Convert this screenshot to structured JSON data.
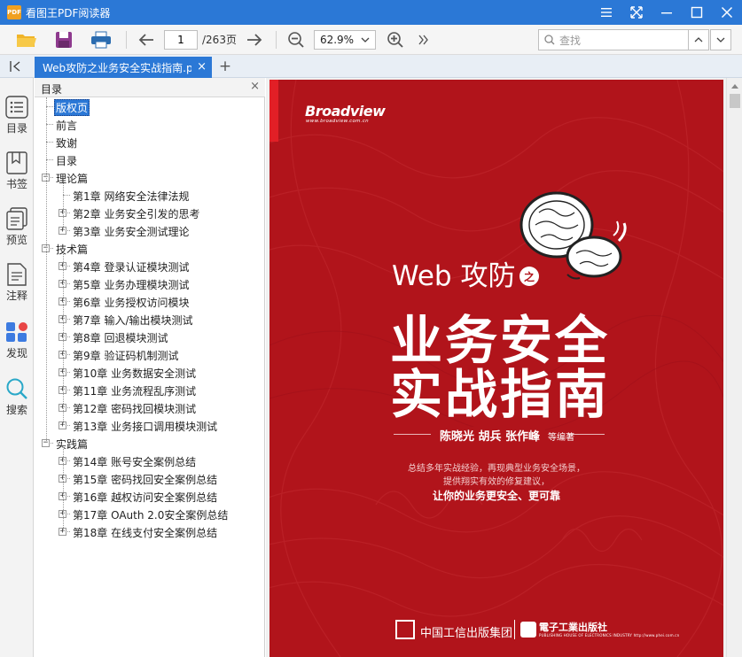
{
  "app": {
    "title": "看图王PDF阅读器",
    "logo_text": "PDF"
  },
  "toolbar": {
    "page_current": "1",
    "page_total": "/263页",
    "zoom": "62.9%",
    "search_placeholder": "查找"
  },
  "tab": {
    "label": "Web攻防之业务安全实战指南.p",
    "close": "×",
    "add": "+"
  },
  "sidebar": {
    "items": [
      {
        "label": "目录",
        "icon": "list-icon"
      },
      {
        "label": "书签",
        "icon": "bookmark-icon"
      },
      {
        "label": "预览",
        "icon": "thumbnails-icon"
      },
      {
        "label": "注释",
        "icon": "annotation-icon"
      },
      {
        "label": "发现",
        "icon": "apps-icon"
      },
      {
        "label": "搜索",
        "icon": "search-icon"
      }
    ]
  },
  "toc": {
    "title": "目录",
    "close": "×",
    "items": [
      {
        "label": "版权页",
        "level": 0,
        "toggle": "",
        "selected": true
      },
      {
        "label": "前言",
        "level": 0,
        "toggle": ""
      },
      {
        "label": "致谢",
        "level": 0,
        "toggle": ""
      },
      {
        "label": "目录",
        "level": 0,
        "toggle": ""
      },
      {
        "label": "理论篇",
        "level": 0,
        "toggle": "−"
      },
      {
        "label": "第1章 网络安全法律法规",
        "level": 1,
        "toggle": ""
      },
      {
        "label": "第2章 业务安全引发的思考",
        "level": 1,
        "toggle": "+"
      },
      {
        "label": "第3章 业务安全测试理论",
        "level": 1,
        "toggle": "+"
      },
      {
        "label": "技术篇",
        "level": 0,
        "toggle": "−"
      },
      {
        "label": "第4章 登录认证模块测试",
        "level": 1,
        "toggle": "+"
      },
      {
        "label": "第5章 业务办理模块测试",
        "level": 1,
        "toggle": "+"
      },
      {
        "label": "第6章 业务授权访问模块",
        "level": 1,
        "toggle": "+"
      },
      {
        "label": "第7章 输入/输出模块测试",
        "level": 1,
        "toggle": "+"
      },
      {
        "label": "第8章 回退模块测试",
        "level": 1,
        "toggle": "+"
      },
      {
        "label": "第9章 验证码机制测试",
        "level": 1,
        "toggle": "+"
      },
      {
        "label": "第10章 业务数据安全测试",
        "level": 1,
        "toggle": "+"
      },
      {
        "label": "第11章 业务流程乱序测试",
        "level": 1,
        "toggle": "+"
      },
      {
        "label": "第12章 密码找回模块测试",
        "level": 1,
        "toggle": "+"
      },
      {
        "label": "第13章 业务接口调用模块测试",
        "level": 1,
        "toggle": "+"
      },
      {
        "label": "实践篇",
        "level": 0,
        "toggle": "−"
      },
      {
        "label": "第14章 账号安全案例总结",
        "level": 1,
        "toggle": "+"
      },
      {
        "label": "第15章 密码找回安全案例总结",
        "level": 1,
        "toggle": "+"
      },
      {
        "label": "第16章 越权访问安全案例总结",
        "level": 1,
        "toggle": "+"
      },
      {
        "label": "第17章 OAuth 2.0安全案例总结",
        "level": 1,
        "toggle": "+"
      },
      {
        "label": "第18章 在线支付安全案例总结",
        "level": 1,
        "toggle": "+"
      }
    ]
  },
  "cover": {
    "publisher_logo": "Broadview",
    "publisher_url": "www.broadview.com.cn",
    "subtitle": "Web 攻防",
    "zhi": "之",
    "title_line1": "业务安全",
    "title_line2": "实战指南",
    "authors": "陈晓光 胡兵 张作峰",
    "etal": "等编著",
    "blurb1": "总结多年实战经验，再现典型业务安全场景，",
    "blurb2": "提供翔实有效的修复建议，",
    "blurb3": "让你的业务更安全、更可靠",
    "publisher1": "中国工信出版集团",
    "publisher2": "電子工業出版社",
    "publisher2_en": "PUBLISHING HOUSE OF ELECTRONICS INDUSTRY",
    "publisher2_url": "http://www.phei.com.cn"
  },
  "colors": {
    "titlebar": "#2b78d6",
    "cover_red": "#b1141b",
    "accent_red": "#e21f26"
  }
}
